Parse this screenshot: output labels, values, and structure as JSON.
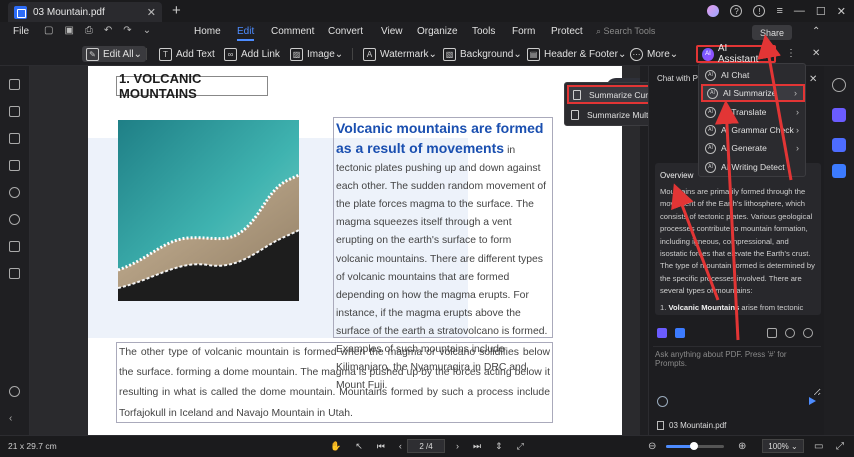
{
  "window": {
    "tab_title": "03 Mountain.pdf",
    "new_tab": "+"
  },
  "menubar": {
    "file": "File",
    "items": [
      "Home",
      "Edit",
      "Comment",
      "Convert",
      "View",
      "Organize",
      "Tools",
      "Form",
      "Protect"
    ],
    "active": "Edit",
    "search_placeholder": "Search Tools",
    "share": "Share"
  },
  "toolbar": {
    "edit_all": "Edit All",
    "add_text": "Add Text",
    "add_link": "Add Link",
    "image": "Image",
    "watermark": "Watermark",
    "background": "Background",
    "header_footer": "Header & Footer",
    "more": "More",
    "ai_assistant": "AI Assistant",
    "ai_badge": "AI"
  },
  "document": {
    "heading": "1. VOLCANIC MOUNTAINS",
    "headline": "Volcanic mountains are formed as a result of movements",
    "col_text": "in tectonic plates pushing up and down against each other. The sudden random movement of the plate forces magma to the surface. The magma squeezes itself through a vent erupting on the earth's surface to form volcanic mountains. There are different types of volcanic mountains that are formed depending on how the magma erupts. For instance, if the magma erupts above the surface of the earth a stratovolcano is formed. Examples of such mountains include Kilimanjaro, the Nyamuragira in DRC and Mount Fuji.",
    "bottom_text": "The other type of volcanic mountain is formed when the magma or volcano solidifies below the surface. forming a dome mountain. The magma is pushed up by the forces acting below it resulting in what is called the dome mountain. Mountains formed by such a process include Torfajokull in Iceland and Navajo Mountain in Utah."
  },
  "summarize_menu": {
    "items": [
      "Summarize Current PDF",
      "Summarize Multiple PDFs"
    ]
  },
  "ai_menu": {
    "items": [
      {
        "label": "AI Chat",
        "arrow": ""
      },
      {
        "label": "AI Summarize",
        "arrow": "›"
      },
      {
        "label": "AI Translate",
        "arrow": "›"
      },
      {
        "label": "AI Grammar Check",
        "arrow": "›"
      },
      {
        "label": "AI Generate",
        "arrow": "›"
      },
      {
        "label": "AI Writing Detect",
        "arrow": ""
      }
    ]
  },
  "ai_panel": {
    "chat_header": "Chat with PDF",
    "overview_title": "Overview",
    "overview_text": "Mountains are primarily formed through the movement of the Earth's lithosphere, which consists of tectonic plates. Various geological processes contribute to mountain formation, including igneous, compressional, and isostatic forces that elevate the Earth's crust. The type of mountain formed is determined by the specific processes involved. There are several types of mountains:",
    "list_bold": "Volcanic Mountains",
    "list_rest": " arise from tectonic",
    "input_placeholder": "Ask anything about PDF. Press '#' for Prompts.",
    "doc_name": "03 Mountain.pdf"
  },
  "statusbar": {
    "dimensions": "21 x 29.7 cm",
    "page": "2 /4",
    "zoom": "100%",
    "zoom_fraction": 0.49
  },
  "colors": {
    "accent": "#4d8cff",
    "highlight_red": "#e23535",
    "headline_blue": "#1a4fb0"
  }
}
